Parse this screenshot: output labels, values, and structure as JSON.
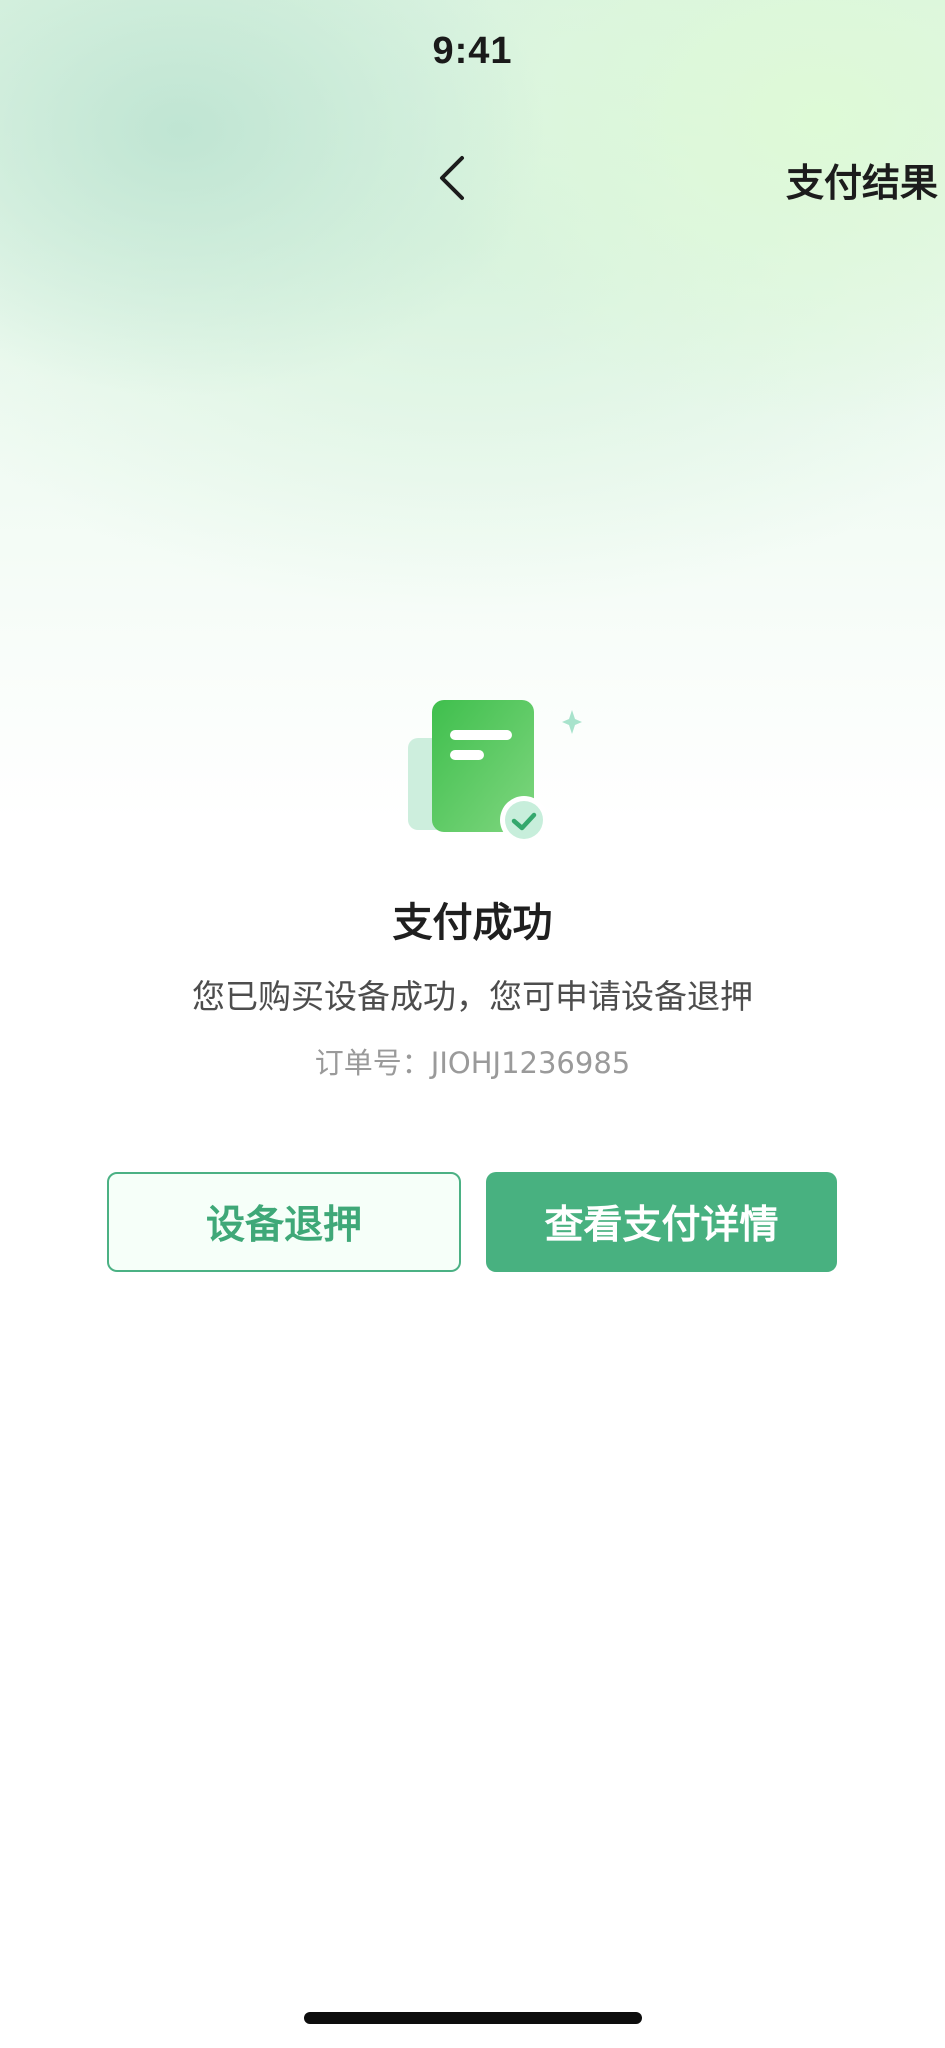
{
  "status_bar": {
    "time": "9:41"
  },
  "nav": {
    "back_icon": "chevron-left-icon",
    "title": "支付结果"
  },
  "result": {
    "icon": "document-check-icon",
    "title": "支付成功",
    "description": "您已购买设备成功，您可申请设备退押",
    "order_label": "订单号：",
    "order_number": "JIOHJ1236985"
  },
  "actions": {
    "refund_deposit_label": "设备退押",
    "view_details_label": "查看支付详情"
  },
  "colors": {
    "brand_green": "#48b180",
    "outline_green": "#4bb184",
    "doc_green": "#42b64a"
  }
}
